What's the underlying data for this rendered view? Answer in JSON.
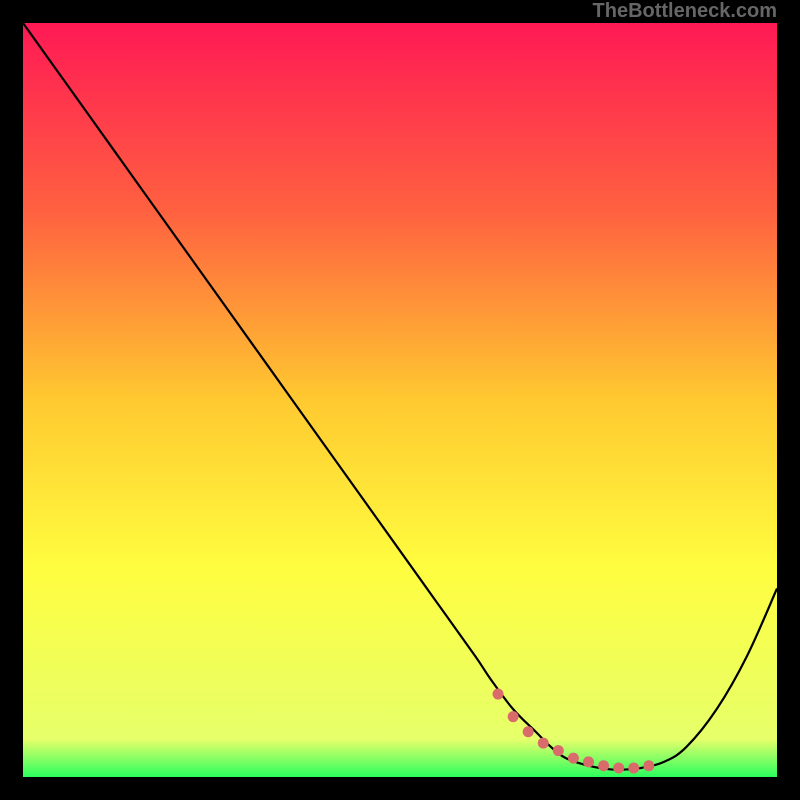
{
  "watermark": "TheBottleneck.com",
  "chart_data": {
    "type": "line",
    "title": "",
    "xlabel": "",
    "ylabel": "",
    "xlim": [
      0,
      100
    ],
    "ylim": [
      0,
      100
    ],
    "gradient_stops": [
      {
        "offset": 0,
        "color": "#ff1955"
      },
      {
        "offset": 25,
        "color": "#ff6140"
      },
      {
        "offset": 50,
        "color": "#ffc930"
      },
      {
        "offset": 72,
        "color": "#fffd3f"
      },
      {
        "offset": 95,
        "color": "#e6ff6a"
      },
      {
        "offset": 100,
        "color": "#2bff5e"
      }
    ],
    "series": [
      {
        "name": "bottleneck-curve",
        "x": [
          0,
          5,
          10,
          15,
          20,
          25,
          30,
          35,
          40,
          45,
          50,
          55,
          60,
          62,
          65,
          68,
          70,
          72,
          75,
          78,
          80,
          82,
          85,
          88,
          92,
          96,
          100
        ],
        "values": [
          100,
          93,
          86,
          79,
          72,
          65,
          58,
          51,
          44,
          37,
          30,
          23,
          16,
          13,
          9,
          6,
          4,
          2.5,
          1.5,
          1,
          1,
          1.2,
          2,
          4,
          9,
          16,
          25
        ]
      }
    ],
    "markers": {
      "name": "highlight-dots",
      "color": "#d96b6b",
      "x": [
        63,
        65,
        67,
        69,
        71,
        73,
        75,
        77,
        79,
        81,
        83
      ],
      "values": [
        11,
        8,
        6,
        4.5,
        3.5,
        2.5,
        2,
        1.5,
        1.2,
        1.2,
        1.5
      ]
    }
  }
}
